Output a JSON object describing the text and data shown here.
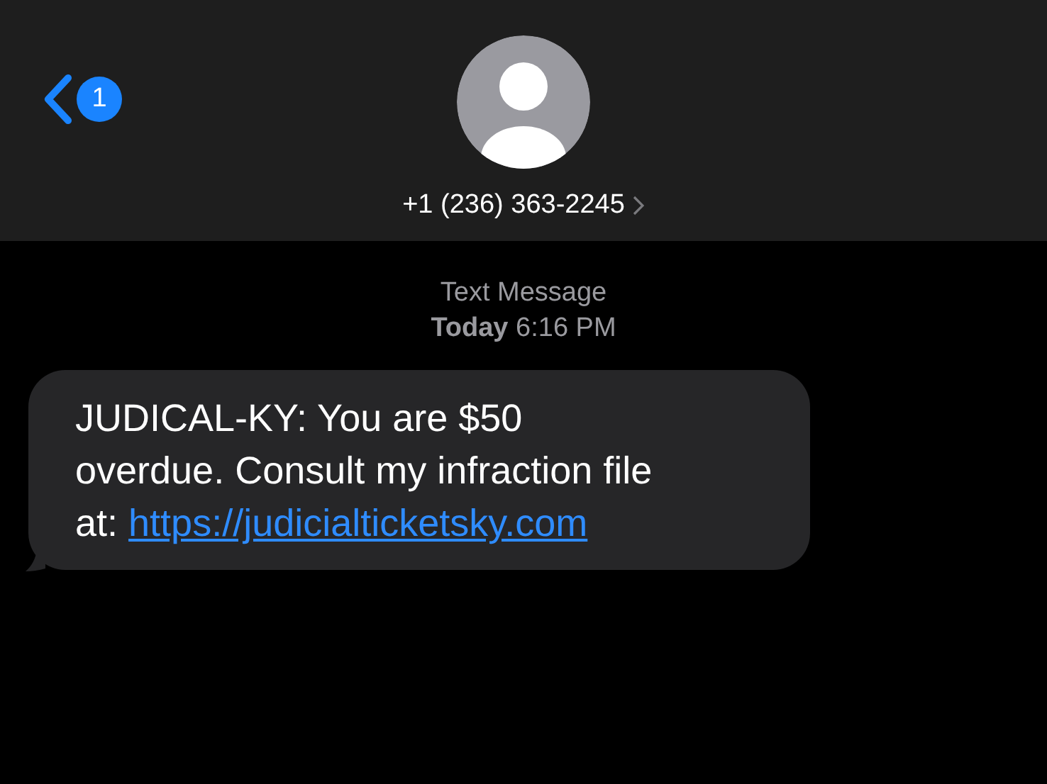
{
  "header": {
    "back_badge": "1",
    "contact": "+1 (236) 363-2245"
  },
  "timestamp": {
    "label": "Text Message",
    "day": "Today",
    "time": "6:16 PM"
  },
  "message": {
    "lines": [
      "JUDICAL-KY: You are $50",
      "overdue. Consult my infraction file",
      "at: "
    ],
    "link": "https://judicialticketsky.com"
  }
}
